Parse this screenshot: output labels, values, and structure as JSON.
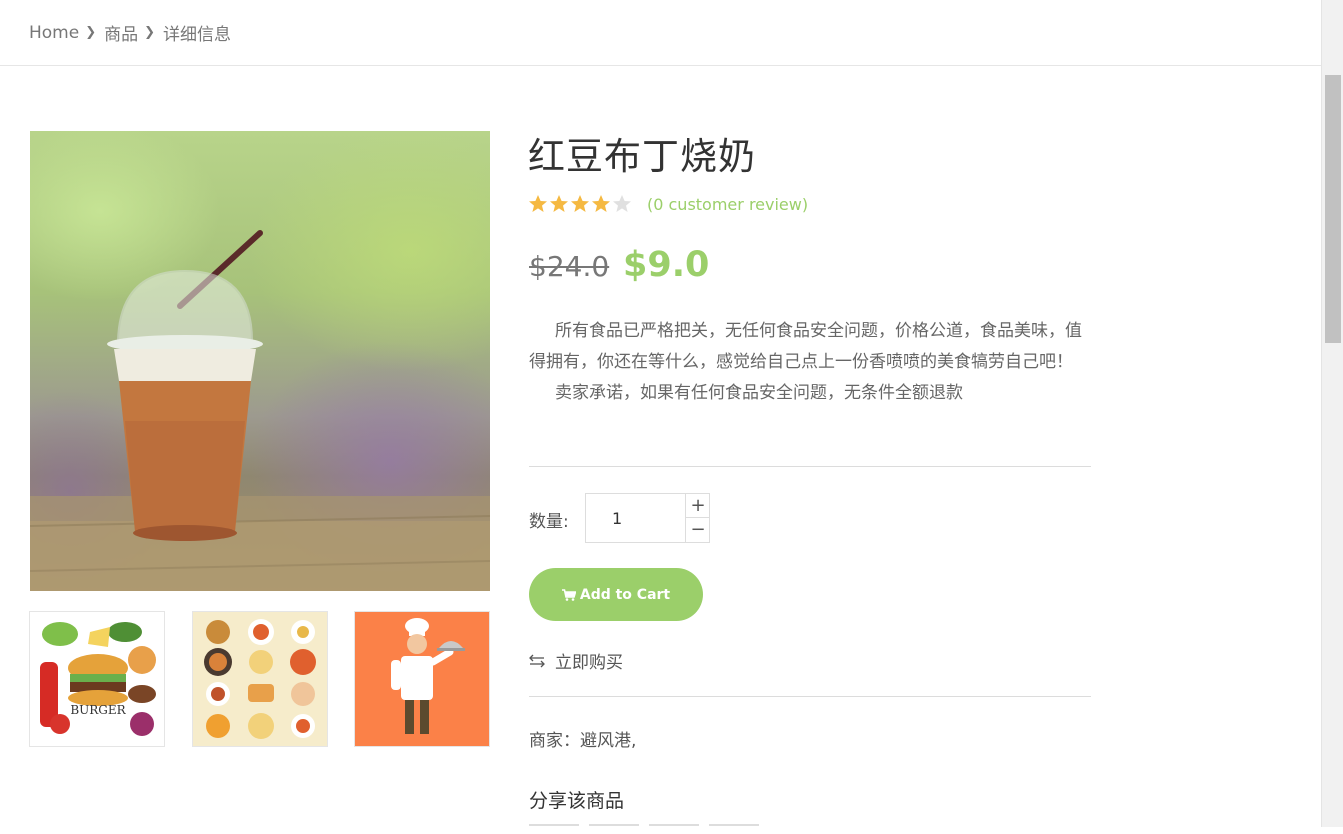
{
  "breadcrumb": {
    "home": "Home",
    "category": "商品",
    "current": "详细信息"
  },
  "product": {
    "title": "红豆布丁烧奶",
    "rating": 4,
    "rating_max": 5,
    "review_text": "(0 customer review)",
    "old_price": "$24.0",
    "new_price": "$9.0",
    "description": [
      "所有食品已严格把关，无任何食品安全问题，价格公道，食品美味，值得拥有，你还在等什么，感觉给自己点上一份香喷喷的美食犒劳自己吧！",
      "卖家承诺，如果有任何食品安全问题，无条件全额退款"
    ],
    "quantity_label": "数量:",
    "quantity": "1",
    "add_to_cart": "Add to Cart",
    "buy_now": "立即购买",
    "merchant": "商家：避风港,",
    "share_title": "分享该商品"
  },
  "thumbnails": [
    {
      "icon": "burger-ingredients-image"
    },
    {
      "icon": "dishes-menu-image"
    },
    {
      "icon": "chef-image"
    }
  ],
  "colors": {
    "accent": "#9bcf6a",
    "star": "#f5b942",
    "star_empty": "#e0e0e0"
  }
}
